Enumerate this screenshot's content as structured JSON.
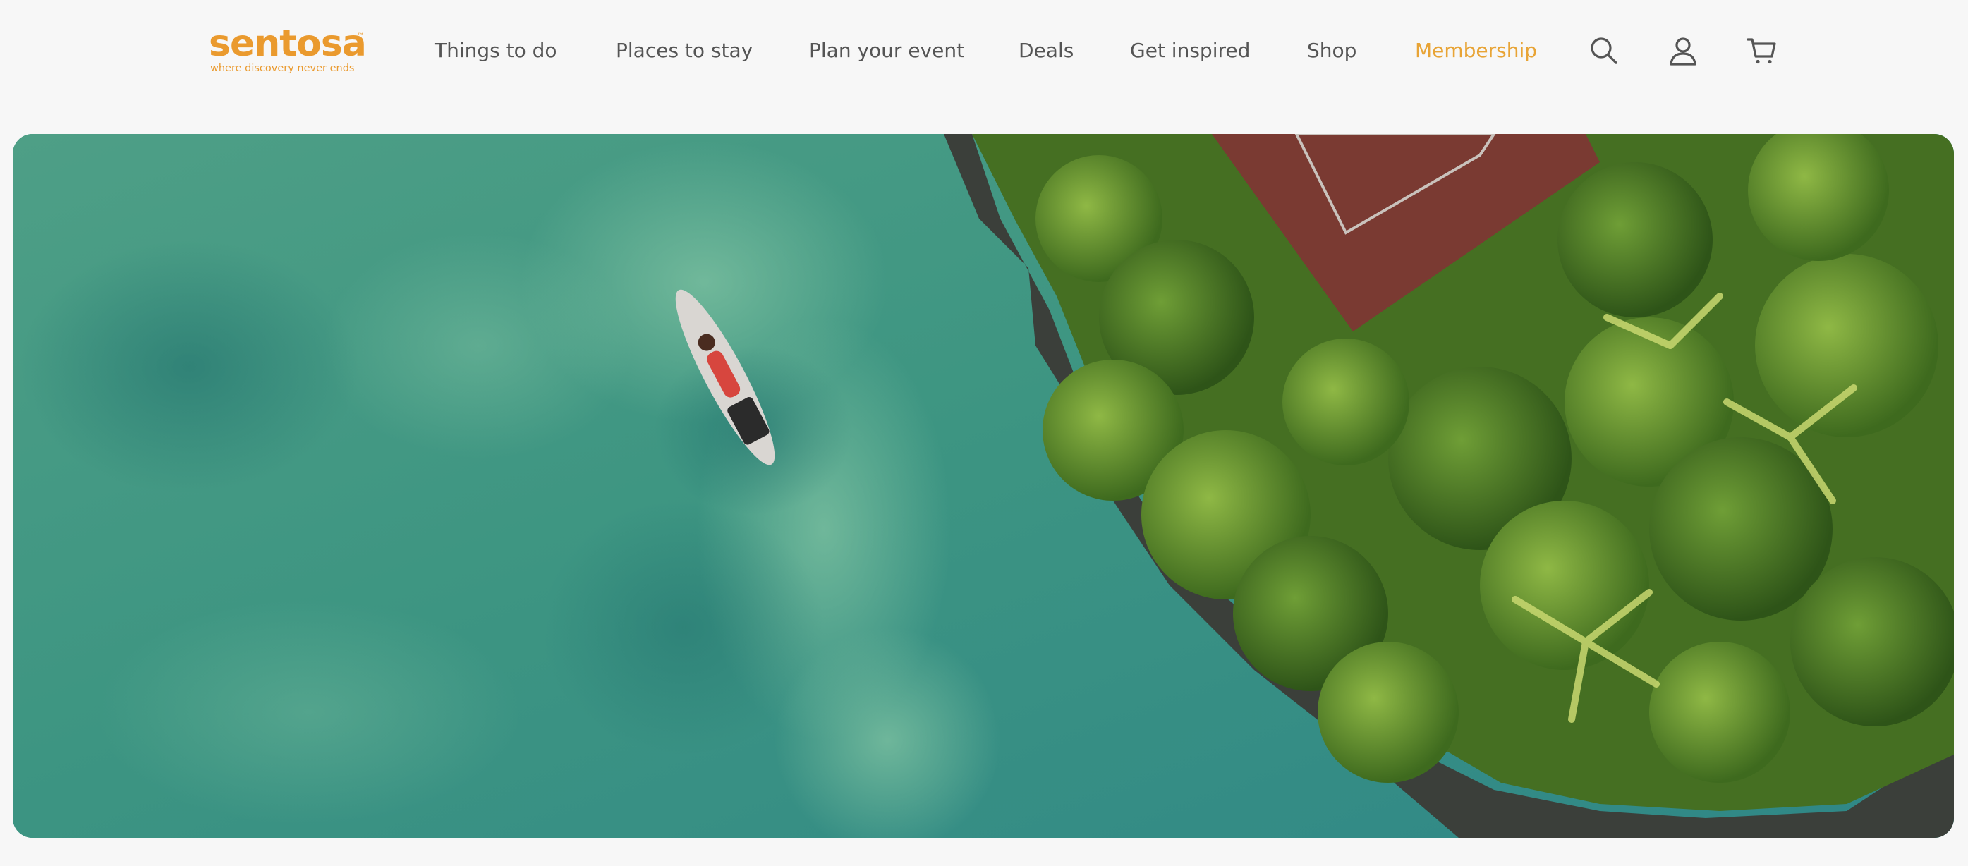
{
  "brand": {
    "name": "sentosa",
    "tagline": "where discovery never ends",
    "trademark": "™",
    "color": "#ea9a2e"
  },
  "nav": {
    "items": [
      {
        "label": "Things to do"
      },
      {
        "label": "Places to stay"
      },
      {
        "label": "Plan your event"
      },
      {
        "label": "Deals"
      },
      {
        "label": "Get inspired"
      },
      {
        "label": "Shop"
      },
      {
        "label": "Membership",
        "highlighted": true
      }
    ],
    "text_color": "#555555",
    "highlight_color": "#e8a436"
  },
  "header_icons": [
    {
      "icon": "search-icon"
    },
    {
      "icon": "user-icon"
    },
    {
      "icon": "cart-icon"
    }
  ],
  "hero": {
    "description_icon": "aerial-photo",
    "colors": {
      "water": "#3f9a82",
      "foliage": "#5a8a2a",
      "roof": "#7a3a32"
    }
  }
}
